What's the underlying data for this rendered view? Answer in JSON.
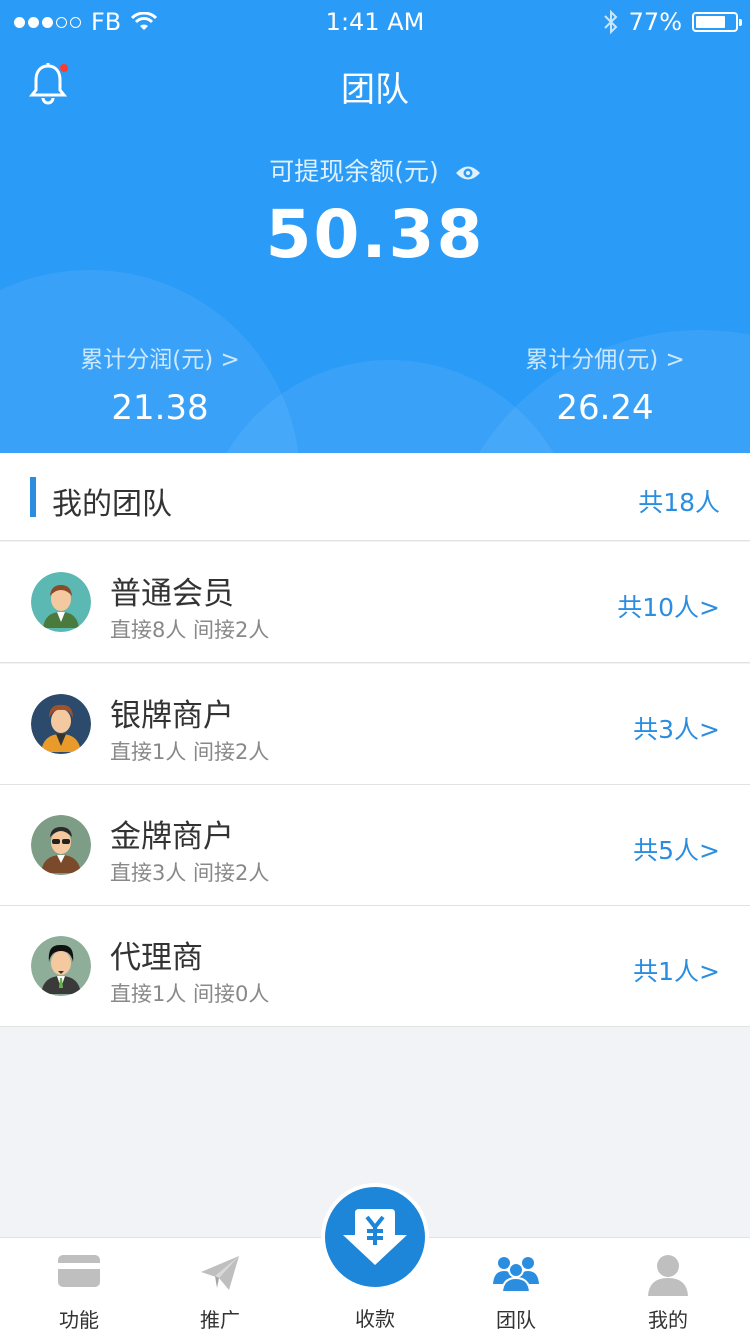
{
  "status_bar": {
    "carrier": "FB",
    "time": "1:41 AM",
    "battery": "77%",
    "battery_level": 0.77
  },
  "header": {
    "title": "团队",
    "balance_label": "可提现余额(元)",
    "balance_value": "50.38",
    "stats": [
      {
        "label": "累计分润(元) >",
        "value": "21.38"
      },
      {
        "label": "累计分佣(元) >",
        "value": "26.24"
      }
    ]
  },
  "team": {
    "title": "我的团队",
    "total": "共18人",
    "members": [
      {
        "name": "普通会员",
        "sub": "直接8人 间接2人",
        "count": "共10人>"
      },
      {
        "name": "银牌商户",
        "sub": "直接1人 间接2人",
        "count": "共3人>"
      },
      {
        "name": "金牌商户",
        "sub": "直接3人 间接2人",
        "count": "共5人>"
      },
      {
        "name": "代理商",
        "sub": "直接1人 间接0人",
        "count": "共1人>"
      }
    ]
  },
  "tabbar": {
    "tabs": [
      {
        "label": "功能",
        "icon": "card-icon"
      },
      {
        "label": "推广",
        "icon": "paper-plane-icon"
      },
      {
        "label": "收款",
        "icon": "yuan-download-icon"
      },
      {
        "label": "团队",
        "icon": "group-icon"
      },
      {
        "label": "我的",
        "icon": "person-icon"
      }
    ]
  },
  "colors": {
    "primary": "#2b9bf8",
    "accent": "#2b8de0",
    "center_button": "#1e86d9"
  }
}
